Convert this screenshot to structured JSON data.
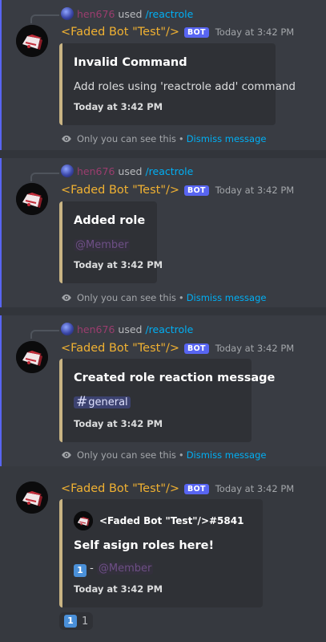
{
  "messages": [
    {
      "reply": {
        "user": "hen676",
        "used": "used",
        "command": "/reactrole"
      },
      "author": "<Faded Bot \"Test\"/>",
      "badge": "BOT",
      "timestamp": "Today at 3:42 PM",
      "embed": {
        "title": "Invalid Command",
        "description": "Add roles using 'reactrole add' command",
        "footer": "Today at 3:42 PM"
      },
      "ephemeral": {
        "text": "Only you can see this",
        "separator": "•",
        "dismiss": "Dismiss message"
      }
    },
    {
      "reply": {
        "user": "hen676",
        "used": "used",
        "command": "/reactrole"
      },
      "author": "<Faded Bot \"Test\"/>",
      "badge": "BOT",
      "timestamp": "Today at 3:42 PM",
      "embed": {
        "title": "Added role",
        "mention": "@Member",
        "footer": "Today at 3:42 PM"
      },
      "ephemeral": {
        "text": "Only you can see this",
        "separator": "•",
        "dismiss": "Dismiss message"
      }
    },
    {
      "reply": {
        "user": "hen676",
        "used": "used",
        "command": "/reactrole"
      },
      "author": "<Faded Bot \"Test\"/>",
      "badge": "BOT",
      "timestamp": "Today at 3:42 PM",
      "embed": {
        "title": "Created role reaction message",
        "channel_hash": "#",
        "channel": "general",
        "footer": "Today at 3:42 PM"
      },
      "ephemeral": {
        "text": "Only you can see this",
        "separator": "•",
        "dismiss": "Dismiss message"
      }
    },
    {
      "author": "<Faded Bot \"Test\"/>",
      "badge": "BOT",
      "timestamp": "Today at 3:42 PM",
      "embed": {
        "author_name": "<Faded Bot \"Test\"/>#5841",
        "title": "Self asign roles here!",
        "line_emoji": "1",
        "line_dash": "-",
        "mention": "@Member",
        "footer": "Today at 3:42 PM"
      },
      "reaction": {
        "emoji": "1",
        "count": "1"
      }
    }
  ],
  "colors": {
    "background": "#36393f",
    "highlight": "#393c43",
    "accent_bar": "#5865f2",
    "embed_bg": "#2f3136",
    "embed_border": "#c9b483",
    "bot_name": "#f0b132",
    "link": "#00aff4",
    "reply_user": "#9b3d6e"
  },
  "icons": {
    "eye": "eye-icon",
    "avatar": "bot-avatar-icon",
    "reply_avatar": "user-avatar-icon"
  }
}
